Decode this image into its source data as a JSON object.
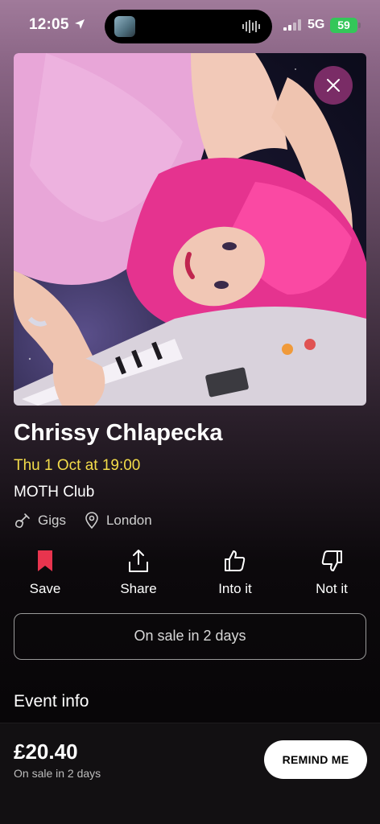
{
  "status_bar": {
    "time": "12:05",
    "network": "5G",
    "battery": "59"
  },
  "event": {
    "title": "Chrissy Chlapecka",
    "datetime": "Thu 1 Oct at 19:00",
    "venue": "MOTH Club",
    "category": "Gigs",
    "location": "London"
  },
  "actions": [
    {
      "label": "Save",
      "icon": "bookmark-icon"
    },
    {
      "label": "Share",
      "icon": "share-icon"
    },
    {
      "label": "Into it",
      "icon": "thumbs-up-icon"
    },
    {
      "label": "Not it",
      "icon": "thumbs-down-icon"
    }
  ],
  "sale_status_button": "On sale in 2 days",
  "section_heading": "Event info",
  "footer": {
    "price": "£20.40",
    "sub": "On sale in 2 days",
    "remind_label": "REMIND ME"
  },
  "colors": {
    "accent_date": "#f3dc4a",
    "save_icon": "#e8344e",
    "close_button": "#7a2c66",
    "battery": "#34c759"
  }
}
